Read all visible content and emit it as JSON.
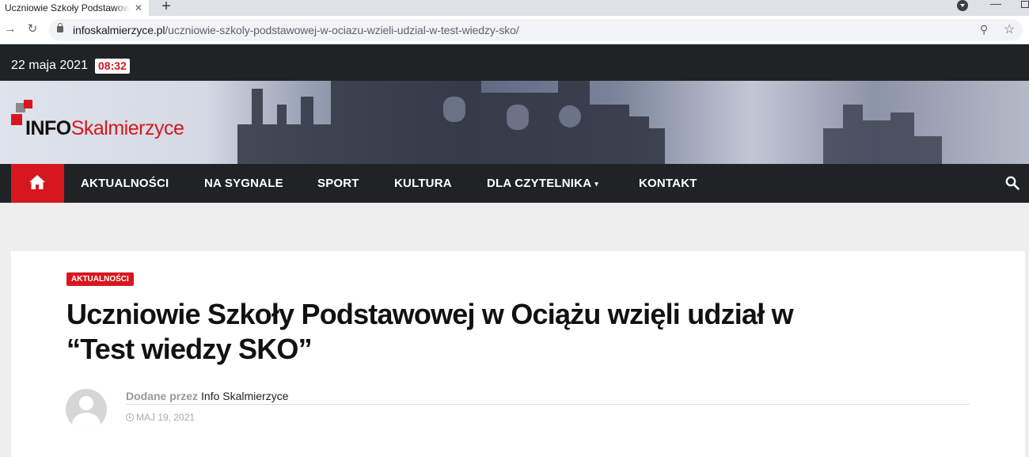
{
  "browser": {
    "tab_title": "Uczniowie Szkoły Podstawowej w Ociążu wzięli udział w “Test wiedzy SKO”",
    "url_host": "infoskalmierzyce.pl",
    "url_path": "/uczniowie-szkoly-podstawowej-w-ociazu-wzieli-udzial-w-test-wiedzy-sko/"
  },
  "topbar": {
    "date": "22 maja 2021",
    "time": "08:32"
  },
  "logo": {
    "part1": "INFO",
    "part2": "Skalmierzyce"
  },
  "nav": {
    "items": [
      {
        "label": "AKTUALNOŚCI"
      },
      {
        "label": "NA SYGNALE"
      },
      {
        "label": "SPORT"
      },
      {
        "label": "KULTURA"
      },
      {
        "label": "DLA CZYTELNIKA"
      },
      {
        "label": "KONTAKT"
      }
    ]
  },
  "post": {
    "category": "AKTUALNOŚCI",
    "title_line1": "Uczniowie Szkoły Podstawowej w Ociążu wzięli udział w",
    "title_line2": "“Test wiedzy SKO”",
    "byline_prefix": "Dodane przez",
    "author": "Info Skalmierzyce",
    "date": "MAJ 19, 2021"
  },
  "colors": {
    "accent": "#d7171f",
    "dark": "#202326"
  },
  "icons": [
    "home-icon",
    "search-icon",
    "clock-icon",
    "lock-icon",
    "star-icon",
    "zoom-icon"
  ]
}
